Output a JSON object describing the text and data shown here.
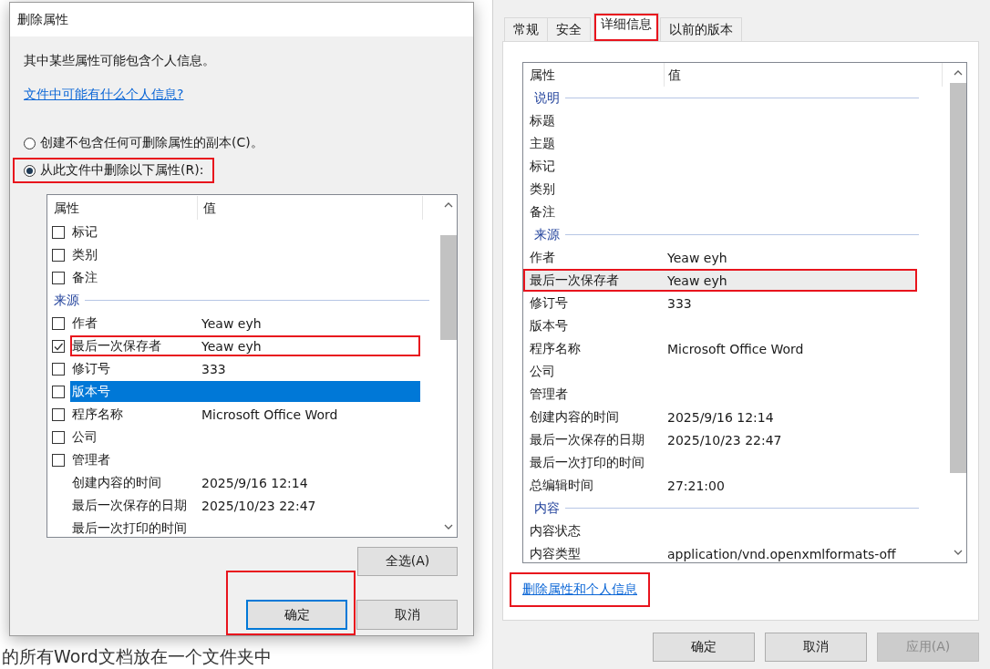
{
  "background_text": "的所有Word文档放在一个文件夹中",
  "remove_dialog": {
    "title": "删除属性",
    "intro": "其中某些属性可能包含个人信息。",
    "help_link": "文件中可能有什么个人信息?",
    "options": [
      {
        "label": "创建不包含任何可删除属性的副本(C)。",
        "selected": false,
        "highlighted": false
      },
      {
        "label": "从此文件中删除以下属性(R):",
        "selected": true,
        "highlighted": true
      }
    ],
    "list": {
      "columns": [
        "属性",
        "值"
      ],
      "rows": [
        {
          "kind": "item",
          "name": "标记",
          "value": "",
          "checked": false,
          "selected": false,
          "highlighted": false
        },
        {
          "kind": "item",
          "name": "类别",
          "value": "",
          "checked": false,
          "selected": false,
          "highlighted": false
        },
        {
          "kind": "item",
          "name": "备注",
          "value": "",
          "checked": false,
          "selected": false,
          "highlighted": false
        },
        {
          "kind": "group",
          "name": "来源"
        },
        {
          "kind": "item",
          "name": "作者",
          "value": "Yeaw eyh",
          "checked": false,
          "selected": false,
          "highlighted": false
        },
        {
          "kind": "item",
          "name": "最后一次保存者",
          "value": "Yeaw eyh",
          "checked": true,
          "selected": false,
          "highlighted": true
        },
        {
          "kind": "item",
          "name": "修订号",
          "value": "333",
          "checked": false,
          "selected": false,
          "highlighted": false
        },
        {
          "kind": "item",
          "name": "版本号",
          "value": "",
          "checked": false,
          "selected": true,
          "highlighted": false
        },
        {
          "kind": "item",
          "name": "程序名称",
          "value": "Microsoft Office Word",
          "checked": false,
          "selected": false,
          "highlighted": false
        },
        {
          "kind": "item",
          "name": "公司",
          "value": "",
          "checked": false,
          "selected": false,
          "highlighted": false
        },
        {
          "kind": "item",
          "name": "管理者",
          "value": "",
          "checked": false,
          "selected": false,
          "highlighted": false
        },
        {
          "kind": "plain",
          "name": "创建内容的时间",
          "value": "2025/9/16 12:14"
        },
        {
          "kind": "plain",
          "name": "最后一次保存的日期",
          "value": "2025/10/23 22:47"
        },
        {
          "kind": "plain",
          "name": "最后一次打印的时间",
          "value": ""
        }
      ]
    },
    "select_all": "全选(A)",
    "buttons": [
      {
        "label": "确定",
        "kind": "framed_default"
      },
      {
        "label": "取消",
        "kind": "normal"
      }
    ]
  },
  "properties_dialog": {
    "tabs": [
      {
        "label": "常规",
        "selected": false,
        "highlighted": false
      },
      {
        "label": "安全",
        "selected": false,
        "highlighted": false
      },
      {
        "label": "详细信息",
        "selected": true,
        "highlighted": true
      },
      {
        "label": "以前的版本",
        "selected": false,
        "highlighted": false
      }
    ],
    "list": {
      "columns": [
        "属性",
        "值"
      ],
      "rows": [
        {
          "kind": "group",
          "name": "说明"
        },
        {
          "kind": "item",
          "name": "标题",
          "value": "",
          "selected": false,
          "highlighted": false
        },
        {
          "kind": "item",
          "name": "主题",
          "value": "",
          "selected": false,
          "highlighted": false
        },
        {
          "kind": "item",
          "name": "标记",
          "value": "",
          "selected": false,
          "highlighted": false
        },
        {
          "kind": "item",
          "name": "类别",
          "value": "",
          "selected": false,
          "highlighted": false
        },
        {
          "kind": "item",
          "name": "备注",
          "value": "",
          "selected": false,
          "highlighted": false
        },
        {
          "kind": "group",
          "name": "来源"
        },
        {
          "kind": "item",
          "name": "作者",
          "value": "Yeaw eyh",
          "selected": false,
          "highlighted": false
        },
        {
          "kind": "item",
          "name": "最后一次保存者",
          "value": "Yeaw eyh",
          "selected": true,
          "highlighted": true
        },
        {
          "kind": "item",
          "name": "修订号",
          "value": "333",
          "selected": false,
          "highlighted": false
        },
        {
          "kind": "item",
          "name": "版本号",
          "value": "",
          "selected": false,
          "highlighted": false
        },
        {
          "kind": "item",
          "name": "程序名称",
          "value": "Microsoft Office Word",
          "selected": false,
          "highlighted": false
        },
        {
          "kind": "item",
          "name": "公司",
          "value": "",
          "selected": false,
          "highlighted": false
        },
        {
          "kind": "item",
          "name": "管理者",
          "value": "",
          "selected": false,
          "highlighted": false
        },
        {
          "kind": "item",
          "name": "创建内容的时间",
          "value": "2025/9/16 12:14",
          "selected": false,
          "highlighted": false
        },
        {
          "kind": "item",
          "name": "最后一次保存的日期",
          "value": "2025/10/23 22:47",
          "selected": false,
          "highlighted": false
        },
        {
          "kind": "item",
          "name": "最后一次打印的时间",
          "value": "",
          "selected": false,
          "highlighted": false
        },
        {
          "kind": "item",
          "name": "总编辑时间",
          "value": "27:21:00",
          "selected": false,
          "highlighted": false
        },
        {
          "kind": "group",
          "name": "内容"
        },
        {
          "kind": "item",
          "name": "内容状态",
          "value": "",
          "selected": false,
          "highlighted": false
        },
        {
          "kind": "item",
          "name": "内容类型",
          "value": "application/vnd.openxmlformats-off",
          "selected": false,
          "highlighted": false
        }
      ]
    },
    "remove_link": {
      "text": "删除属性和个人信息",
      "highlighted": true
    },
    "buttons": [
      {
        "label": "确定",
        "disabled": false
      },
      {
        "label": "取消",
        "disabled": false
      },
      {
        "label": "应用(A)",
        "disabled": true
      }
    ]
  }
}
